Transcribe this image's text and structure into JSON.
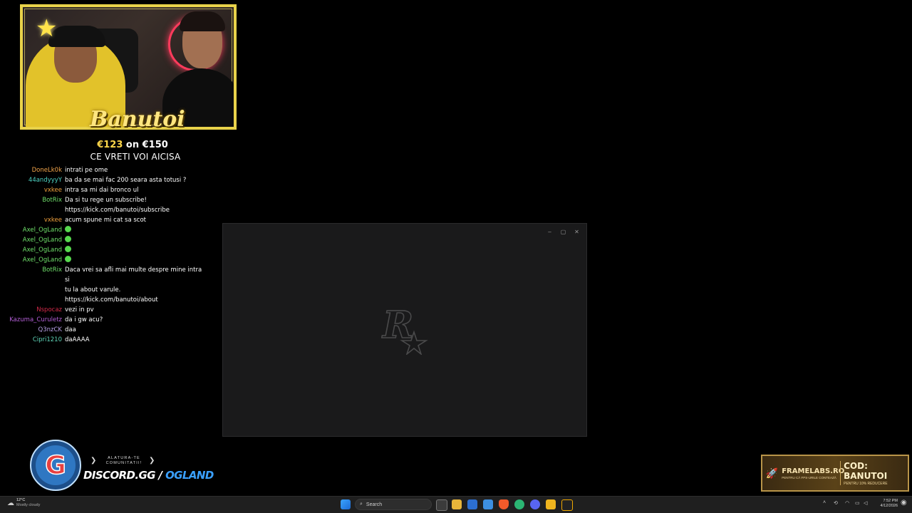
{
  "stream": {
    "streamer_name": "Banutoi",
    "goal_current": "€123",
    "goal_on": "on",
    "goal_target": "€150",
    "headline": "CE VRETI VOI AICISA"
  },
  "chat": {
    "messages": [
      {
        "user": "DoneLk0k",
        "color": "#f4a64b",
        "text": "intrati pe ome"
      },
      {
        "user": "44andyyyY",
        "color": "#4fd4c4",
        "text": "ba da se mai fac 200 seara asta totusi ?"
      },
      {
        "user": "vxkee",
        "color": "#f1a13d",
        "text": "intra sa mi dai bronco ul"
      },
      {
        "user": "BotRix",
        "color": "#6fe06a",
        "text": "Da si tu rege un subscribe!"
      },
      {
        "user": "",
        "color": "#fff",
        "text": "https://kick.com/banutoi/subscribe"
      },
      {
        "user": "vxkee",
        "color": "#f1a13d",
        "text": "acum spune mi cat sa scot"
      },
      {
        "user": "Axel_OgLand",
        "color": "#6fe06a",
        "text": "",
        "emote": true
      },
      {
        "user": "Axel_OgLand",
        "color": "#6fe06a",
        "text": "",
        "emote": true
      },
      {
        "user": "Axel_OgLand",
        "color": "#6fe06a",
        "text": "",
        "emote": true
      },
      {
        "user": "Axel_OgLand",
        "color": "#6fe06a",
        "text": "",
        "emote": true
      },
      {
        "user": "BotRix",
        "color": "#6fe06a",
        "text": "Daca vrei sa afli mai multe despre mine intra si"
      },
      {
        "user": "",
        "color": "#fff",
        "text": "tu la about varule."
      },
      {
        "user": "",
        "color": "#fff",
        "text": "https://kick.com/banutoi/about"
      },
      {
        "user": "Nspocaz",
        "color": "#d42a4a",
        "text": "vezi in pv"
      },
      {
        "user": "Kazuma_Curuletz",
        "color": "#b35fd6",
        "text": "da i gw acu?"
      },
      {
        "user": "Q3nzCK",
        "color": "#b9a2e8",
        "text": "daa"
      },
      {
        "user": "Cipri1210",
        "color": "#5fd4b8",
        "text": "daAAAA"
      }
    ]
  },
  "window": {
    "minimize_label": "–",
    "maximize_label": "▢",
    "close_label": "✕",
    "logo_icon": "rockstar-logo"
  },
  "community": {
    "join_line1": "ALATURA-TE",
    "join_line2": "COMUNITATII!",
    "discord_prefix": "DISCORD.GG",
    "discord_sep": "/",
    "discord_code": "OGLAND"
  },
  "sponsor": {
    "brand": "FRAMELABS.RO",
    "brand_tagline": "PENTRU CĂ FPS-URILE CONTEAZĂ",
    "code": "COD: BANUTOI",
    "code_tagline": "PENTRU 10% REDUCERE"
  },
  "taskbar": {
    "weather_temp": "12°C",
    "weather_desc": "Mostly cloudy",
    "search_placeholder": "Search",
    "time": "7:52 PM",
    "date": "4/12/2026"
  },
  "colors": {
    "accent_gold": "#e8d24a",
    "discord_blue": "#3aa0ff",
    "window_bg": "#1a1a1b"
  }
}
